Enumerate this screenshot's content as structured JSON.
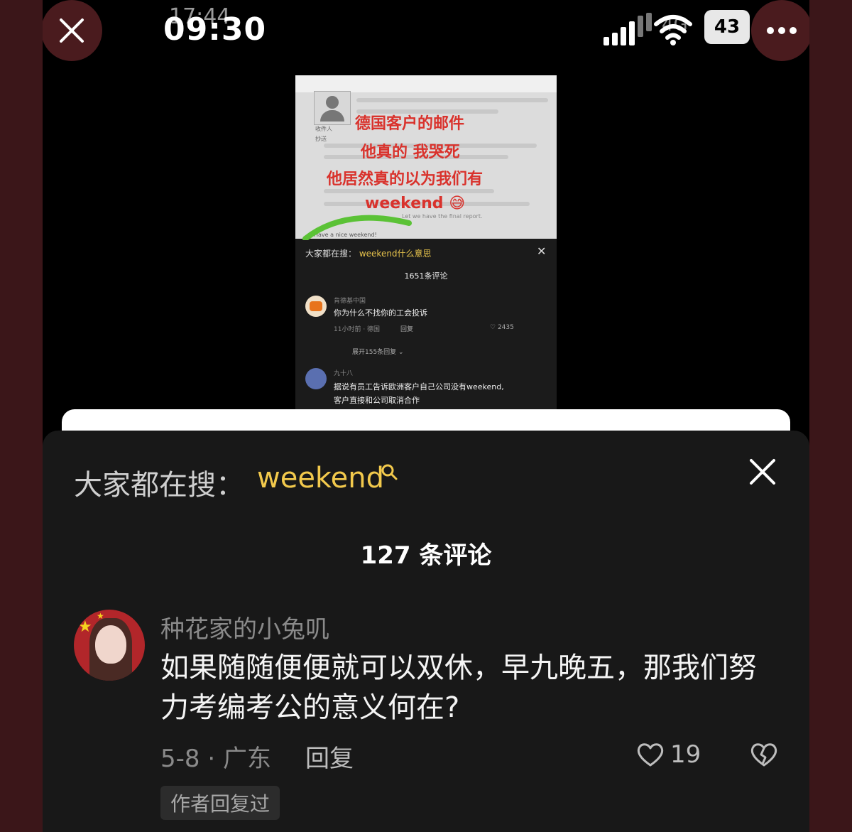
{
  "status_bar": {
    "time": "09:30",
    "time_behind": "17:44",
    "network": "4G",
    "battery": "43"
  },
  "colors": {
    "accent_keyword": "#f2c94c",
    "panel_bg": "#181818",
    "frame_bg": "#3b1619"
  },
  "embedded_screenshot": {
    "email_overlay_lines": [
      "德国客户的邮件",
      "他真的 我哭死",
      "他居然真的以为我们有",
      "weekend 😅"
    ],
    "email_snippets": [
      "收件人",
      "抄送",
      "Have a nice weekend!",
      "Let we have the final report."
    ],
    "search_prefix": "大家都在搜：",
    "search_keyword": "weekend什么意思",
    "comment_count": "1651条评论",
    "comment1_user": "肯德基中国",
    "comment1_text": "你为什么不找你的工会投诉",
    "comment1_meta": "11小时前 · 德国",
    "comment1_reply": "回复",
    "comment1_likes": "2435",
    "expand_replies": "展开155条回复",
    "comment2_user": "九十八",
    "comment2_text_line1": "据说有员工告诉欧洲客户自己公司没有weekend,",
    "comment2_text_line2": "客户直接和公司取消合作"
  },
  "panel": {
    "search_prefix": "大家都在搜：",
    "search_keyword": "weekend",
    "comment_count": "127 条评论",
    "comment": {
      "username": "种花家的小兔叽",
      "text": "如果随随便便就可以双休，早九晚五，那我们努力考编考公的意义何在?",
      "meta": "5-8 · 广东",
      "reply_label": "回复",
      "likes": "19",
      "author_badge": "作者回复过"
    }
  },
  "icons": [
    "close-icon",
    "more-icon",
    "signal-icon",
    "wifi-icon",
    "search-icon",
    "heart-icon",
    "broken-heart-icon"
  ]
}
